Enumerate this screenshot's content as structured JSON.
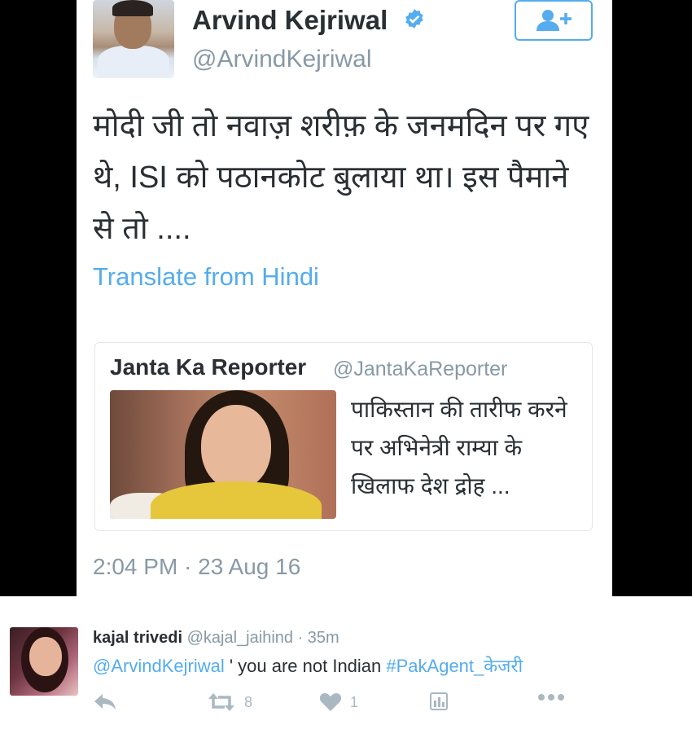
{
  "tweet": {
    "author_name": "Arvind Kejriwal",
    "author_handle": "@ArvindKejriwal",
    "text": "मोदी जी तो नवाज़ शरीफ़ के जनमदिन पर गए थे, ISI को पठानकोट बुलाया था। इस पैमाने से तो ....",
    "translate_label": "Translate from Hindi",
    "timestamp": "2:04 PM · 23 Aug 16",
    "quote": {
      "name": "Janta Ka Reporter",
      "handle": "@JantaKaReporter",
      "text": "पाकिस्तान की तारीफ करने पर अभिनेत्री राम्या के खिलाफ देश द्रोह ..."
    }
  },
  "reply": {
    "name": "kajal trivedi",
    "handle": "@kajal_jaihind",
    "separator": " · ",
    "time": "35m",
    "mention": "@ArvindKejriwal",
    "body": "  ' you are not Indian ",
    "hashtag": "#PakAgent_केजरी",
    "actions": {
      "retweet_count": "8",
      "like_count": "1"
    }
  },
  "colors": {
    "accent": "#55acee",
    "text": "#292f33",
    "muted": "#8899a6",
    "icon": "#aab8c2"
  },
  "icons": [
    "verified-badge-icon",
    "follow-user-icon",
    "reply-icon",
    "retweet-icon",
    "like-heart-icon",
    "analytics-icon",
    "more-icon"
  ]
}
